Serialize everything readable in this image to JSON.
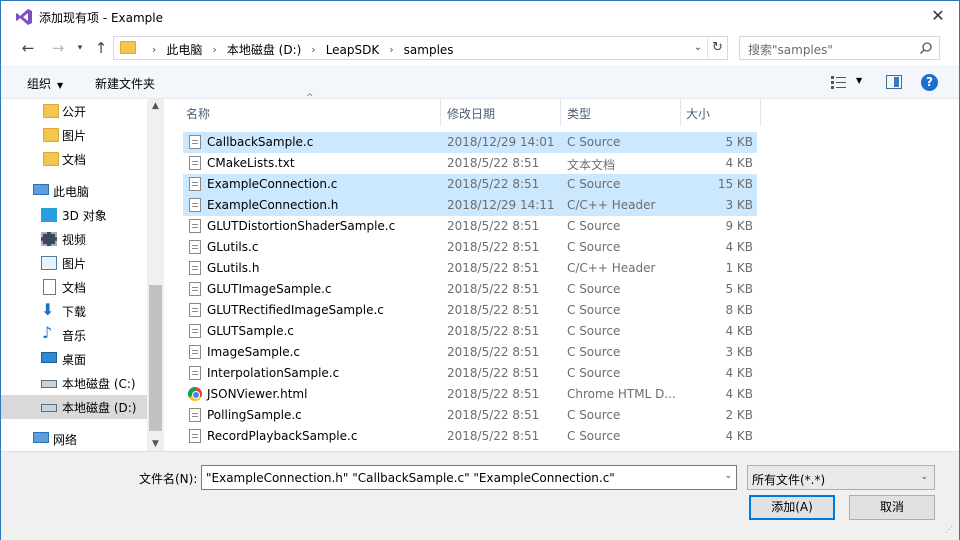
{
  "window": {
    "title": "添加现有项 - Example"
  },
  "address": {
    "crumbs": [
      "此电脑",
      "本地磁盘 (D:)",
      "LeapSDK",
      "samples"
    ],
    "search_placeholder": "搜索\"samples\""
  },
  "toolbar": {
    "organize": "组织",
    "new_folder": "新建文件夹"
  },
  "sidebar": {
    "items": [
      {
        "label": "公开",
        "icon": "folder-icon"
      },
      {
        "label": "图片",
        "icon": "folder-icon"
      },
      {
        "label": "文档",
        "icon": "folder-icon"
      },
      {
        "label": "此电脑",
        "icon": "computer-icon"
      },
      {
        "label": "3D 对象",
        "icon": "3d-objects-icon"
      },
      {
        "label": "视频",
        "icon": "video-icon"
      },
      {
        "label": "图片",
        "icon": "pictures-icon"
      },
      {
        "label": "文档",
        "icon": "documents-icon"
      },
      {
        "label": "下载",
        "icon": "download-icon"
      },
      {
        "label": "音乐",
        "icon": "music-icon"
      },
      {
        "label": "桌面",
        "icon": "desktop-icon"
      },
      {
        "label": "本地磁盘 (C:)",
        "icon": "drive-icon"
      },
      {
        "label": "本地磁盘 (D:)",
        "icon": "drive-icon",
        "selected": true
      },
      {
        "label": "网络",
        "icon": "network-icon"
      }
    ]
  },
  "list": {
    "columns": {
      "name": "名称",
      "date": "修改日期",
      "type": "类型",
      "size": "大小"
    },
    "rows": [
      {
        "name": "CallbackSample.c",
        "date": "2018/12/29 14:01",
        "type": "C Source",
        "size": "5 KB",
        "selected": true
      },
      {
        "name": "CMakeLists.txt",
        "date": "2018/5/22 8:51",
        "type": "文本文档",
        "size": "4 KB"
      },
      {
        "name": "ExampleConnection.c",
        "date": "2018/5/22 8:51",
        "type": "C Source",
        "size": "15 KB",
        "selected": true
      },
      {
        "name": "ExampleConnection.h",
        "date": "2018/12/29 14:11",
        "type": "C/C++ Header",
        "size": "3 KB",
        "selected": true
      },
      {
        "name": "GLUTDistortionShaderSample.c",
        "date": "2018/5/22 8:51",
        "type": "C Source",
        "size": "9 KB"
      },
      {
        "name": "GLutils.c",
        "date": "2018/5/22 8:51",
        "type": "C Source",
        "size": "4 KB"
      },
      {
        "name": "GLutils.h",
        "date": "2018/5/22 8:51",
        "type": "C/C++ Header",
        "size": "1 KB"
      },
      {
        "name": "GLUTImageSample.c",
        "date": "2018/5/22 8:51",
        "type": "C Source",
        "size": "5 KB"
      },
      {
        "name": "GLUTRectifiedImageSample.c",
        "date": "2018/5/22 8:51",
        "type": "C Source",
        "size": "8 KB"
      },
      {
        "name": "GLUTSample.c",
        "date": "2018/5/22 8:51",
        "type": "C Source",
        "size": "4 KB"
      },
      {
        "name": "ImageSample.c",
        "date": "2018/5/22 8:51",
        "type": "C Source",
        "size": "3 KB"
      },
      {
        "name": "InterpolationSample.c",
        "date": "2018/5/22 8:51",
        "type": "C Source",
        "size": "4 KB"
      },
      {
        "name": "JSONViewer.html",
        "date": "2018/5/22 8:51",
        "type": "Chrome HTML D...",
        "size": "4 KB",
        "chrome": true
      },
      {
        "name": "PollingSample.c",
        "date": "2018/5/22 8:51",
        "type": "C Source",
        "size": "2 KB"
      },
      {
        "name": "RecordPlaybackSample.c",
        "date": "2018/5/22 8:51",
        "type": "C Source",
        "size": "4 KB"
      }
    ]
  },
  "footer": {
    "filename_label": "文件名(N):",
    "filename_value": "\"ExampleConnection.h\" \"CallbackSample.c\" \"ExampleConnection.c\"",
    "filetype_value": "所有文件(*.*)",
    "add_button": "添加(A)",
    "cancel_button": "取消"
  },
  "colors": {
    "accent": "#0078d7",
    "selection": "#cce8ff",
    "titlebar_border": "#2b78c2"
  }
}
